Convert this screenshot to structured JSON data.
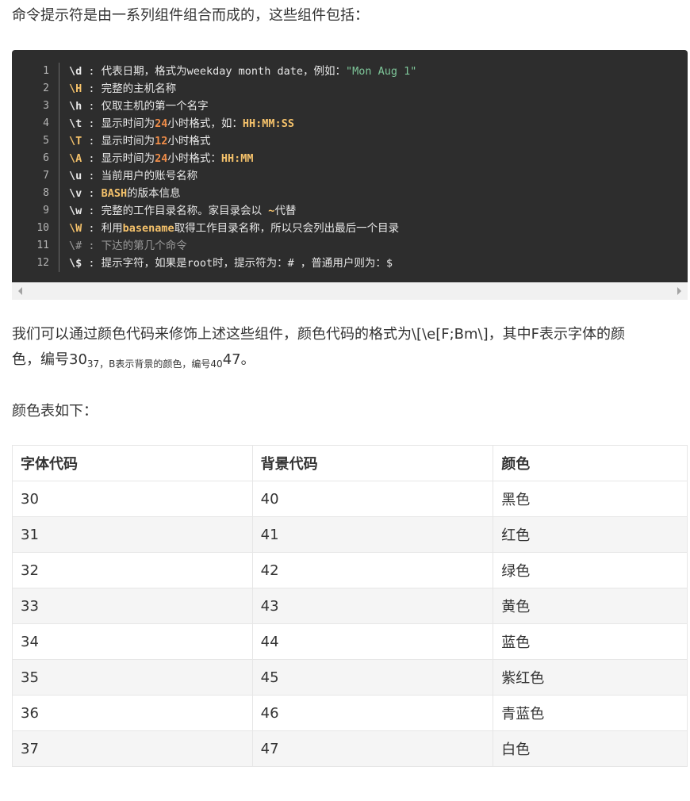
{
  "intro": "命令提示符是由一系列组件组合而成的，这些组件包括：",
  "code_lines": [
    {
      "n": "1",
      "esc": "\\d",
      "desc": "代表日期，格式为weekday month date，例如：",
      "str": "\"Mon Aug 1\""
    },
    {
      "n": "2",
      "esc": "\\H",
      "desc": "完整的主机名称"
    },
    {
      "n": "3",
      "esc": "\\h",
      "desc": "仅取主机的第一个名字"
    },
    {
      "n": "4",
      "esc": "\\t",
      "pre": "显示时间为",
      "num": "24",
      "post": "小时格式，如：",
      "kw": "HH:MM:SS"
    },
    {
      "n": "5",
      "esc": "\\T",
      "pre": "显示时间为",
      "num": "12",
      "post": "小时格式"
    },
    {
      "n": "6",
      "esc": "\\A",
      "pre": "显示时间为",
      "num": "24",
      "post": "小时格式：",
      "kw": "HH:MM"
    },
    {
      "n": "7",
      "esc": "\\u",
      "desc": "当前用户的账号名称"
    },
    {
      "n": "8",
      "esc": "\\v",
      "kw": "BASH",
      "post": "的版本信息"
    },
    {
      "n": "9",
      "esc": "\\w",
      "desc": "完整的工作目录名称。家目录会以 ",
      "kw": "~",
      "post": "代替"
    },
    {
      "n": "10",
      "esc": "\\W",
      "pre": "利用",
      "kw": "basename",
      "post": "取得工作目录名称，所以只会列出最后一个目录"
    },
    {
      "n": "11",
      "esc": "\\#",
      "desc": "下达的第几个命令"
    },
    {
      "n": "12",
      "esc": "\\$",
      "desc": "提示字符，如果是root时，提示符为：# ，普通用户则为：$"
    }
  ],
  "para2": {
    "line1": "我们可以通过颜色代码来修饰上述这些组件，颜色代码的格式为\\[\\e[F;Bm\\]，其中F表示字体的颜",
    "line2_a": "色，编号30",
    "line2_b": "37，B表示背景的颜色，编号40",
    "line2_c": "47。"
  },
  "para3": "颜色表如下：",
  "table": {
    "headers": [
      "字体代码",
      "背景代码",
      "颜色"
    ],
    "rows": [
      [
        "30",
        "40",
        "黑色"
      ],
      [
        "31",
        "41",
        "红色"
      ],
      [
        "32",
        "42",
        "绿色"
      ],
      [
        "33",
        "43",
        "黄色"
      ],
      [
        "34",
        "44",
        "蓝色"
      ],
      [
        "35",
        "45",
        "紫红色"
      ],
      [
        "36",
        "46",
        "青蓝色"
      ],
      [
        "37",
        "47",
        "白色"
      ]
    ]
  }
}
